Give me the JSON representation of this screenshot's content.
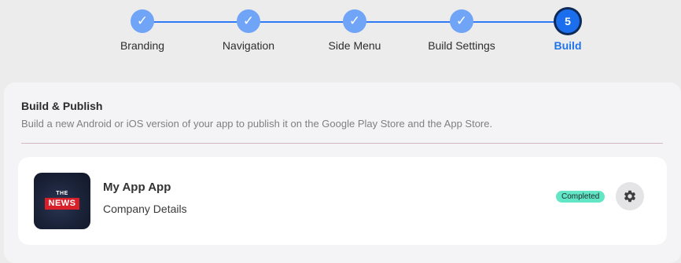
{
  "stepper": {
    "steps": [
      {
        "label": "Branding",
        "marker": "✓",
        "state": "completed"
      },
      {
        "label": "Navigation",
        "marker": "✓",
        "state": "completed"
      },
      {
        "label": "Side Menu",
        "marker": "✓",
        "state": "completed"
      },
      {
        "label": "Build Settings",
        "marker": "✓",
        "state": "completed"
      },
      {
        "label": "Build",
        "marker": "5",
        "state": "active"
      }
    ]
  },
  "panel": {
    "title": "Build & Publish",
    "subtitle": "Build a new Android or iOS version of your app to publish it on the Google Play Store and the App Store."
  },
  "app": {
    "name": "My App App",
    "details_link": "Company Details",
    "status": "Completed",
    "logo": {
      "line1": "THE",
      "line2": "NEWS"
    }
  },
  "colors": {
    "accent": "#2f7bf5",
    "completed_step": "#6fa4f6",
    "active_step": "#1b6fee",
    "status_badge": "#63e6c6"
  },
  "icons": {
    "settings": "gear-icon",
    "completed_step": "checkmark-icon"
  }
}
